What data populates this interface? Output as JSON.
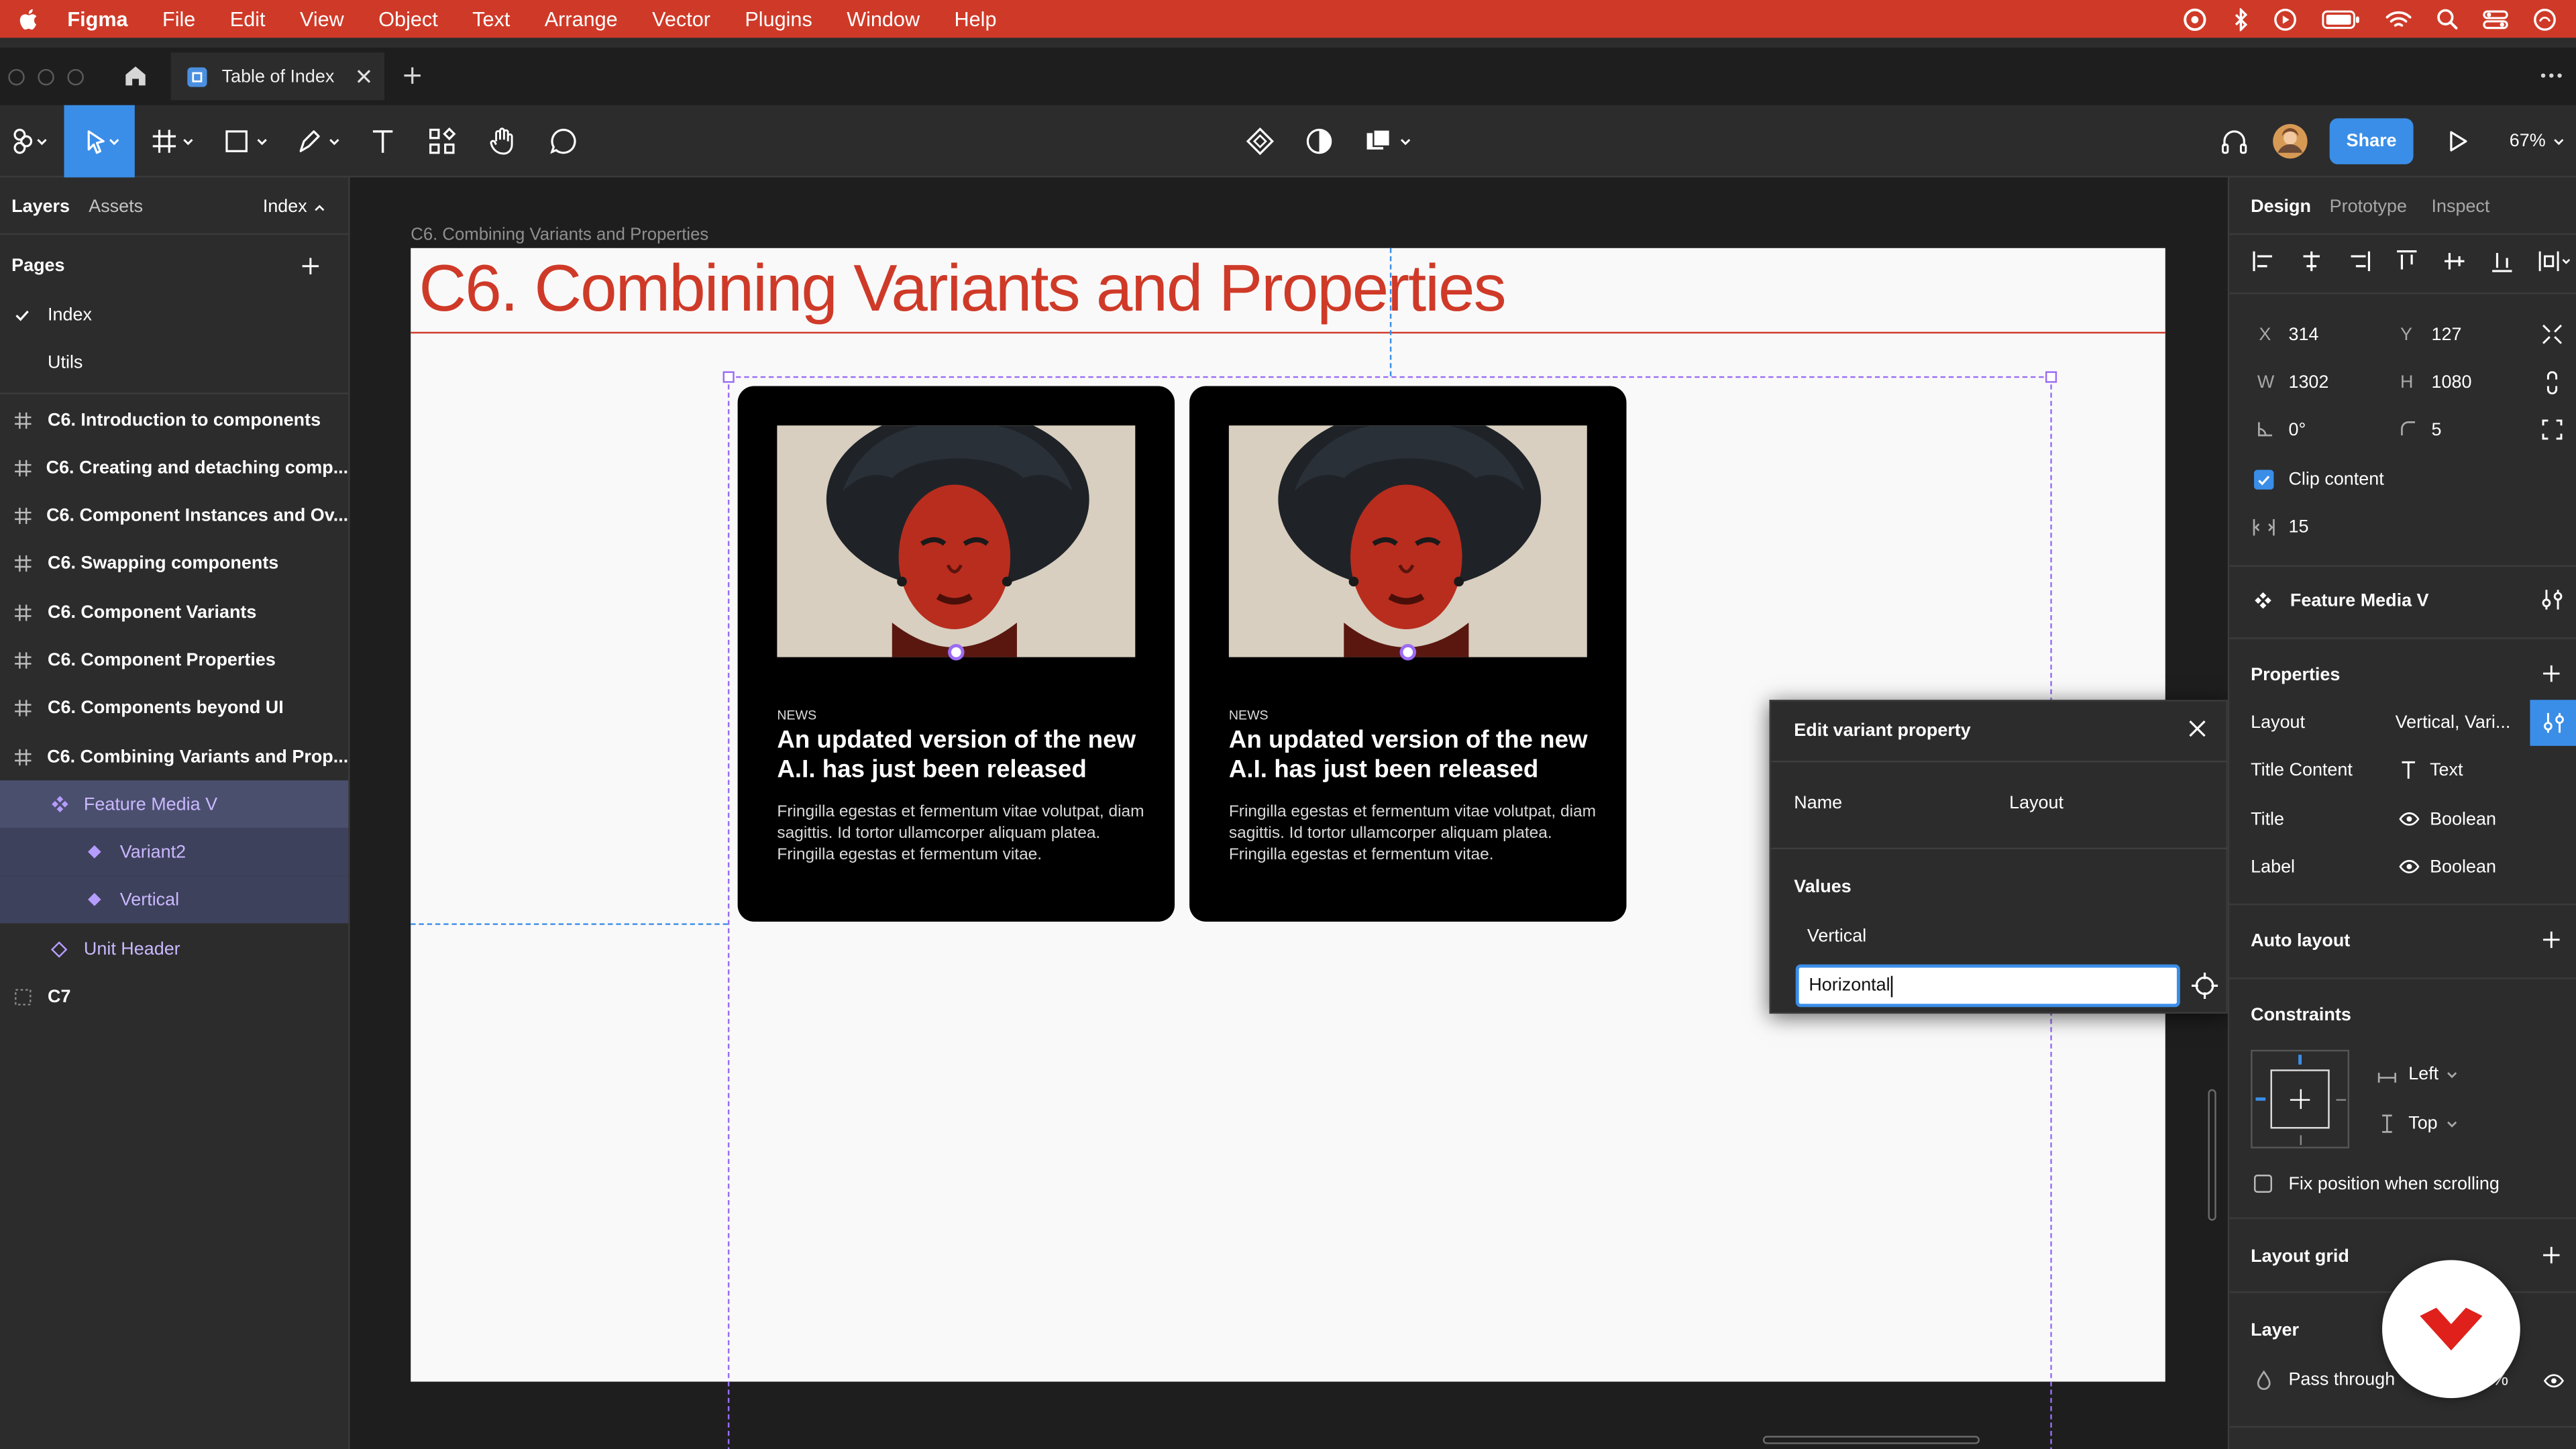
{
  "menubar": {
    "app": "Figma",
    "items": [
      "File",
      "Edit",
      "View",
      "Object",
      "Text",
      "Arrange",
      "Vector",
      "Plugins",
      "Window",
      "Help"
    ]
  },
  "tab": {
    "title": "Table of Index"
  },
  "toolbar": {
    "share_label": "Share",
    "zoom": "67%"
  },
  "left_panel": {
    "tabs": [
      "Layers",
      "Assets"
    ],
    "page_selector": "Index",
    "pages_title": "Pages",
    "pages": [
      {
        "label": "Index",
        "current": true
      },
      {
        "label": "Utils",
        "current": false
      }
    ],
    "layers": [
      {
        "label": "C6. Introduction to components",
        "kind": "frame"
      },
      {
        "label": "C6. Creating and detaching comp...",
        "kind": "frame"
      },
      {
        "label": "C6. Component Instances and Ov...",
        "kind": "frame"
      },
      {
        "label": "C6. Swapping components",
        "kind": "frame"
      },
      {
        "label": "C6. Component Variants",
        "kind": "frame"
      },
      {
        "label": "C6. Component Properties",
        "kind": "frame"
      },
      {
        "label": "C6. Components beyond UI",
        "kind": "frame"
      },
      {
        "label": "C6. Combining Variants and Prop...",
        "kind": "frame"
      },
      {
        "label": "Feature Media V",
        "kind": "component-set"
      },
      {
        "label": "Variant2",
        "kind": "variant"
      },
      {
        "label": "Vertical",
        "kind": "variant"
      },
      {
        "label": "Unit Header",
        "kind": "component"
      },
      {
        "label": "C7",
        "kind": "frame-dotted"
      }
    ]
  },
  "canvas": {
    "frame_label": "C6. Combining Variants and Properties",
    "heading": "C6.  Combining Variants and Properties",
    "cards": [
      {
        "kicker": "NEWS",
        "headline": "An updated version of the new A.I. has just been released",
        "body": "Fringilla egestas et fermentum vitae volutpat, diam sagittis. Id tortor ullamcorper aliquam platea. Fringilla egestas et fermentum vitae."
      },
      {
        "kicker": "NEWS",
        "headline": "An updated version of the new A.I. has just been released",
        "body": "Fringilla egestas et fermentum vitae volutpat, diam sagittis. Id tortor ullamcorper aliquam platea. Fringilla egestas et fermentum vitae."
      }
    ]
  },
  "dialog": {
    "title": "Edit variant property",
    "name_label": "Name",
    "name_value": "Layout",
    "values_label": "Values",
    "value_1": "Vertical",
    "value_2_input": "Horizontal"
  },
  "right_panel": {
    "tabs": [
      "Design",
      "Prototype",
      "Inspect"
    ],
    "x_label": "X",
    "x_value": "314",
    "y_label": "Y",
    "y_value": "127",
    "w_label": "W",
    "w_value": "1302",
    "h_label": "H",
    "h_value": "1080",
    "rotation": "0°",
    "corner_radius": "5",
    "clip_content": "Clip content",
    "spacing": "15",
    "component_name": "Feature Media V",
    "properties_title": "Properties",
    "properties": [
      {
        "name": "Layout",
        "value": "Vertical, Vari..."
      },
      {
        "name": "Title Content",
        "value": "Text"
      },
      {
        "name": "Title",
        "value": "Boolean"
      },
      {
        "name": "Label",
        "value": "Boolean"
      }
    ],
    "auto_layout": "Auto layout",
    "constraints_title": "Constraints",
    "constraint_h": "Left",
    "constraint_v": "Top",
    "fix_position": "Fix position when scrolling",
    "layout_grid": "Layout grid",
    "layer_title": "Layer",
    "blend_mode": "Pass through",
    "opacity_fragment": "%"
  },
  "colors": {
    "menubar_bg": "#cf3a28",
    "accent_blue": "#4a8fe0",
    "heading_red": "#cf3a28",
    "selection_purple": "#9b6cf5"
  }
}
